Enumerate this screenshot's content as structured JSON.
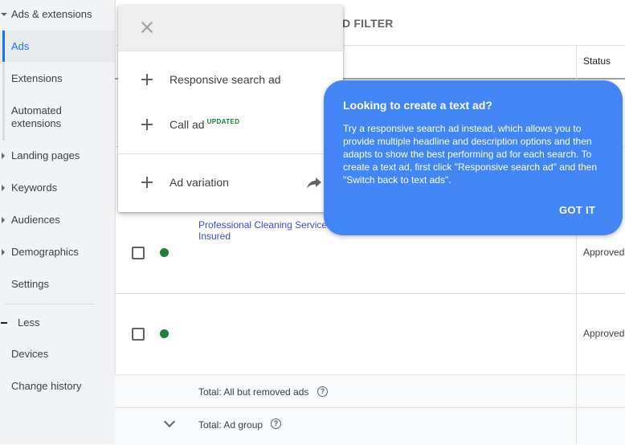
{
  "sidebar": {
    "items": [
      {
        "label": "Ads & extensions"
      },
      {
        "label": "Ads"
      },
      {
        "label": "Extensions"
      },
      {
        "label": "Automated extensions"
      },
      {
        "label": "Landing pages"
      },
      {
        "label": "Keywords"
      },
      {
        "label": "Audiences"
      },
      {
        "label": "Demographics"
      },
      {
        "label": "Settings"
      },
      {
        "label": "Less"
      },
      {
        "label": "Devices"
      },
      {
        "label": "Change history"
      }
    ]
  },
  "toolbar": {
    "filter_label": "D FILTER"
  },
  "table": {
    "status_header": "Status",
    "rows": [
      {
        "ad_text": "Professional Cleaning Service Insured",
        "status": "Approved"
      },
      {
        "ad_text": "",
        "status": "Approved"
      }
    ],
    "totals": [
      {
        "label": "Total: All but removed ads"
      },
      {
        "label": "Total: Ad group"
      }
    ]
  },
  "menu": {
    "items": [
      {
        "label": "Responsive search ad"
      },
      {
        "label": "Call ad",
        "badge": "UPDATED"
      },
      {
        "label": "Ad variation"
      }
    ]
  },
  "tooltip": {
    "title": "Looking to create a text ad?",
    "body": "Try a responsive search ad instead, which allows you to provide multiple headline and description options and then adapts to show the best performing ad for each search. To create a text ad, first click \"Responsive search ad\" and then \"Switch back to text ads\".",
    "button": "GOT IT"
  },
  "colors": {
    "accent": "#1a73e8",
    "tooltip_bg": "#4285f4",
    "status_enabled": "#188038",
    "link": "#3c4ec4"
  },
  "icons": {
    "close": "close-icon",
    "add": "plus-icon",
    "share": "share-arrow-icon",
    "help": "help-icon",
    "expand": "chevron-down-icon"
  }
}
